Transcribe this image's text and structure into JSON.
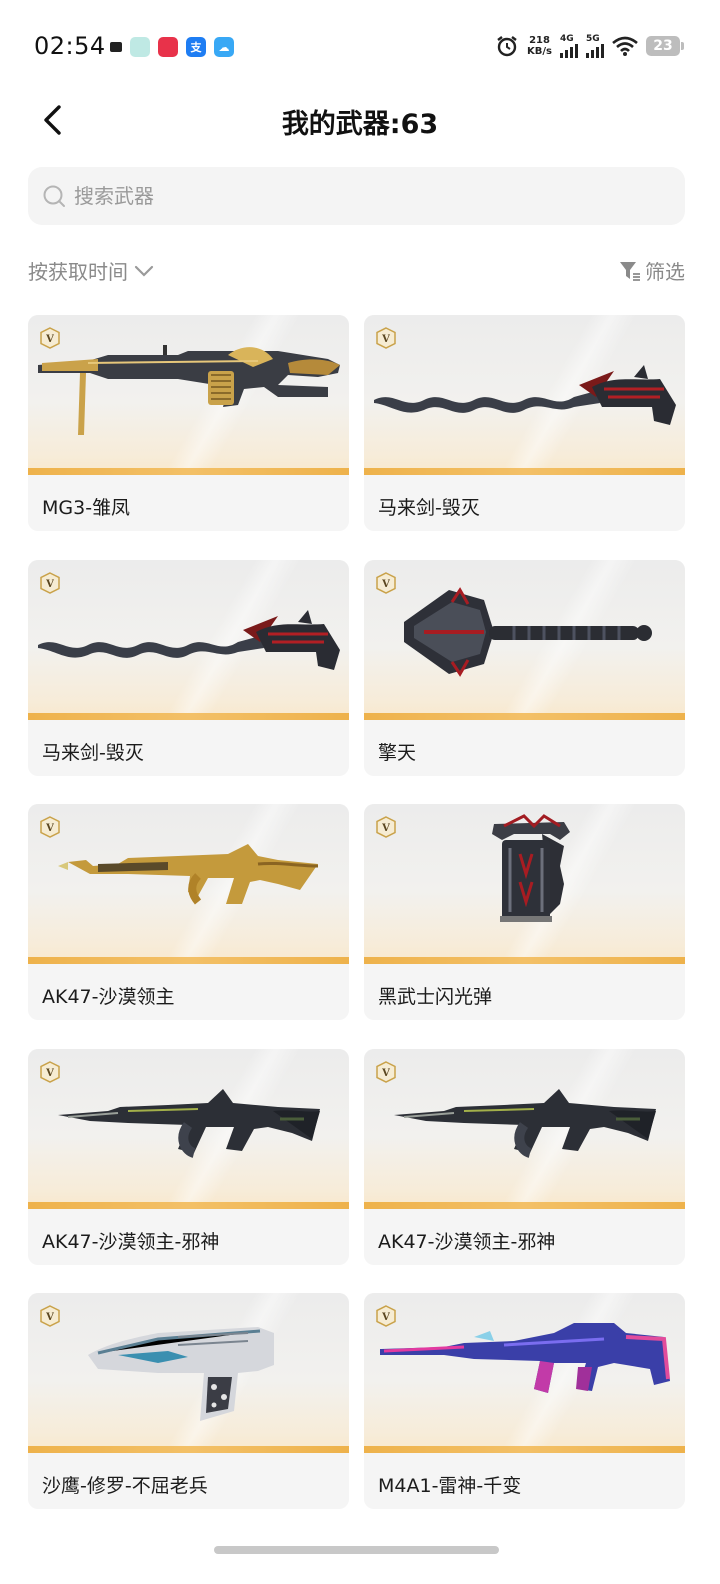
{
  "status_bar": {
    "time": "02:54",
    "net_speed_value": "218",
    "net_speed_unit": "KB/s",
    "signal_1": "4G",
    "signal_2": "5G",
    "battery": "23"
  },
  "header": {
    "title": "我的武器:63"
  },
  "search": {
    "placeholder": "搜索武器"
  },
  "toolbar": {
    "sort_label": "按获取时间",
    "filter_label": "筛选"
  },
  "weapons": [
    {
      "name": "MG3-雏凤",
      "kind": "machinegun-gold"
    },
    {
      "name": "马来剑-毁灭",
      "kind": "kris"
    },
    {
      "name": "马来剑-毁灭",
      "kind": "kris"
    },
    {
      "name": "擎天",
      "kind": "shovel"
    },
    {
      "name": "AK47-沙漠领主",
      "kind": "ak-gold"
    },
    {
      "name": "黑武士闪光弹",
      "kind": "grenade"
    },
    {
      "name": "AK47-沙漠领主-邪神",
      "kind": "ak-dark"
    },
    {
      "name": "AK47-沙漠领主-邪神",
      "kind": "ak-dark"
    },
    {
      "name": "沙鹰-修罗-不屈老兵",
      "kind": "deagle"
    },
    {
      "name": "M4A1-雷神-千变",
      "kind": "m4-neon"
    }
  ],
  "colors": {
    "accent_stripe": "#eeb24b",
    "badge_gold": "#c9a24a",
    "card_bg": "#f5f5f5"
  }
}
